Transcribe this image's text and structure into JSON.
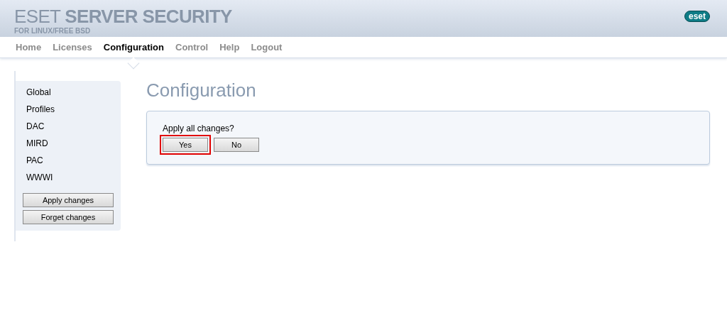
{
  "header": {
    "title_light": "ESET",
    "title_bold": "SERVER SECURITY",
    "subtitle": "FOR LINUX/FREE BSD",
    "logo": "eset"
  },
  "nav": [
    {
      "label": "Home",
      "selected": false
    },
    {
      "label": "Licenses",
      "selected": false
    },
    {
      "label": "Configuration",
      "selected": true
    },
    {
      "label": "Control",
      "selected": false
    },
    {
      "label": "Help",
      "selected": false
    },
    {
      "label": "Logout",
      "selected": false
    }
  ],
  "sidebar": {
    "items": [
      "Global",
      "Profiles",
      "DAC",
      "MIRD",
      "PAC",
      "WWWI"
    ],
    "buttons": [
      "Apply changes",
      "Forget changes"
    ]
  },
  "page_title": "Configuration",
  "dialog": {
    "question": "Apply all changes?",
    "buttons": [
      {
        "label": "Yes",
        "highlighted": true
      },
      {
        "label": "No",
        "highlighted": false
      }
    ]
  }
}
